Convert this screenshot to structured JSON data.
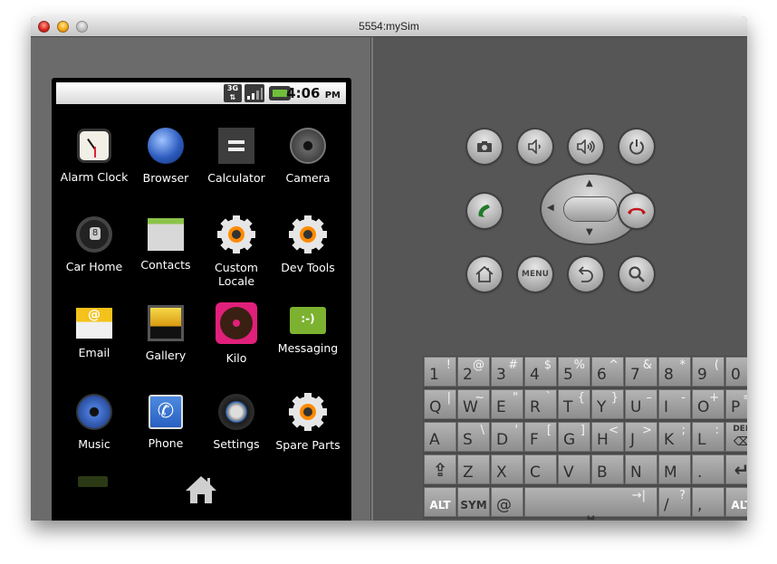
{
  "window": {
    "title": "5554:mySim",
    "controls": [
      "close",
      "minimize",
      "zoom"
    ]
  },
  "statusbar": {
    "network": "3G",
    "time": "4:06",
    "ampm": "PM",
    "icons": [
      "3g-data-icon",
      "signal-strength-icon",
      "battery-charging-icon"
    ]
  },
  "apps": [
    {
      "label": "Alarm Clock",
      "icon": "alarm-clock-icon"
    },
    {
      "label": "Browser",
      "icon": "globe-icon"
    },
    {
      "label": "Calculator",
      "icon": "calculator-icon"
    },
    {
      "label": "Camera",
      "icon": "camera-lens-icon"
    },
    {
      "label": "Car Home",
      "icon": "steering-wheel-icon"
    },
    {
      "label": "Contacts",
      "icon": "contacts-book-icon"
    },
    {
      "label": "Custom Locale",
      "icon": "gear-icon"
    },
    {
      "label": "Dev Tools",
      "icon": "gear-icon"
    },
    {
      "label": "Email",
      "icon": "email-envelope-icon"
    },
    {
      "label": "Gallery",
      "icon": "gallery-picture-icon"
    },
    {
      "label": "Kilo",
      "icon": "donut-icon"
    },
    {
      "label": "Messaging",
      "icon": "speech-bubble-icon"
    },
    {
      "label": "Music",
      "icon": "speaker-icon"
    },
    {
      "label": "Phone",
      "icon": "phone-handset-icon"
    },
    {
      "label": "Settings",
      "icon": "settings-knob-icon"
    },
    {
      "label": "Spare Parts",
      "icon": "gear-icon"
    }
  ],
  "dock": {
    "home_icon": "home-icon",
    "widget": "android-widget"
  },
  "hardware_buttons": {
    "row1": [
      {
        "name": "camera",
        "glyph": "📷"
      },
      {
        "name": "volume-down",
        "glyph": "🔉"
      },
      {
        "name": "volume-up",
        "glyph": "🔊"
      },
      {
        "name": "power",
        "glyph": "⏻"
      }
    ],
    "call": {
      "glyph": "✆",
      "color": "#1f7a2a"
    },
    "end_call": {
      "glyph": "☎",
      "color": "#c0161b"
    },
    "row3": [
      {
        "name": "home",
        "glyph": "⌂"
      },
      {
        "name": "menu",
        "glyph": "MENU"
      },
      {
        "name": "back",
        "glyph": "↶"
      },
      {
        "name": "search",
        "glyph": "⚲"
      }
    ],
    "dpad": {
      "up": "▲",
      "down": "▼",
      "left": "◀",
      "right": "▶"
    }
  },
  "keyboard": {
    "rows": [
      [
        {
          "m": "1",
          "a": "!"
        },
        {
          "m": "2",
          "a": "@"
        },
        {
          "m": "3",
          "a": "#"
        },
        {
          "m": "4",
          "a": "$"
        },
        {
          "m": "5",
          "a": "%"
        },
        {
          "m": "6",
          "a": "^"
        },
        {
          "m": "7",
          "a": "&"
        },
        {
          "m": "8",
          "a": "*"
        },
        {
          "m": "9",
          "a": "("
        },
        {
          "m": "0",
          "a": ")"
        }
      ],
      [
        {
          "m": "Q",
          "a": "|"
        },
        {
          "m": "W",
          "a": "~"
        },
        {
          "m": "E",
          "a": "\""
        },
        {
          "m": "R",
          "a": "`"
        },
        {
          "m": "T",
          "a": "{"
        },
        {
          "m": "Y",
          "a": "}"
        },
        {
          "m": "U",
          "a": "–"
        },
        {
          "m": "I",
          "a": "-"
        },
        {
          "m": "O",
          "a": "+"
        },
        {
          "m": "P",
          "a": "="
        }
      ],
      [
        {
          "m": "A",
          "a": ""
        },
        {
          "m": "S",
          "a": "\\"
        },
        {
          "m": "D",
          "a": "'"
        },
        {
          "m": "F",
          "a": "["
        },
        {
          "m": "G",
          "a": "]"
        },
        {
          "m": "H",
          "a": "<"
        },
        {
          "m": "J",
          "a": ">"
        },
        {
          "m": "K",
          "a": ";"
        },
        {
          "m": "L",
          "a": ":"
        },
        {
          "m": "⌫",
          "a": "DEL"
        }
      ],
      [
        {
          "m": "⇪",
          "a": ""
        },
        {
          "m": "Z",
          "a": ""
        },
        {
          "m": "X",
          "a": ""
        },
        {
          "m": "C",
          "a": ""
        },
        {
          "m": "V",
          "a": ""
        },
        {
          "m": "B",
          "a": ""
        },
        {
          "m": "N",
          "a": ""
        },
        {
          "m": "M",
          "a": ""
        },
        {
          "m": ".",
          "a": ""
        },
        {
          "m": "↵",
          "a": ""
        }
      ]
    ],
    "bottom_row": {
      "alt_left": "ALT",
      "sym": "SYM",
      "at": "@",
      "space": "⎵",
      "tab": "→|",
      "slash": "/",
      "question": "?",
      "comma": ",",
      "alt_right": "ALT"
    }
  }
}
